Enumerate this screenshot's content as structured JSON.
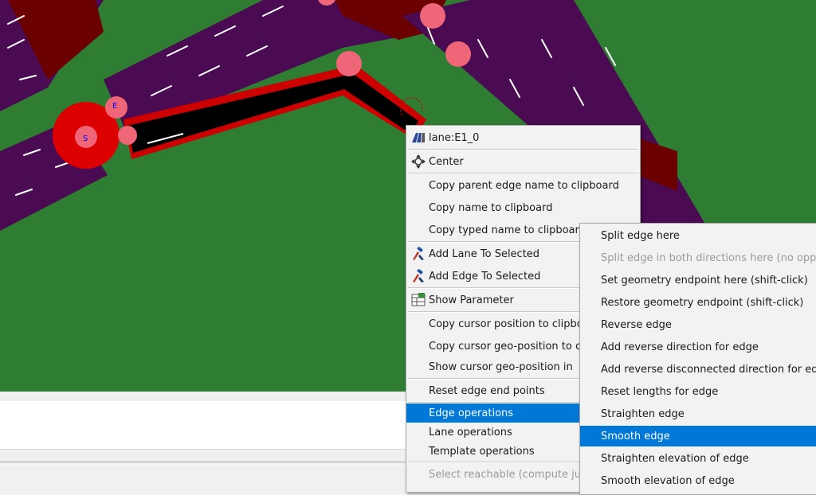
{
  "colors": {
    "grass": "#2e7d32",
    "road": "#4a0b52",
    "junction": "#7a0000",
    "selected_lane": "#000000",
    "highlight": "#0078d7",
    "node_marker": "#ee6677"
  },
  "map": {
    "junction_label": "S",
    "endpoint_label": "E"
  },
  "context_menu": {
    "title": "lane:E1_0",
    "title_icon": "lane-icon",
    "items": [
      {
        "label": "Center",
        "icon": "center-crosshair-icon"
      },
      {
        "label": "Copy parent edge name to clipboard"
      },
      {
        "label": "Copy name to clipboard"
      },
      {
        "label": "Copy typed name to clipboard"
      },
      {
        "label": "Add Lane To Selected",
        "icon": "add-selected-icon"
      },
      {
        "label": "Add Edge To Selected",
        "icon": "add-selected-icon"
      },
      {
        "label": "Show Parameter",
        "icon": "parameter-table-icon"
      },
      {
        "label": "Copy cursor position to clipboard"
      },
      {
        "label": "Copy cursor geo-position to clipboard"
      },
      {
        "label": "Show cursor geo-position in"
      },
      {
        "label": "Reset edge end points"
      },
      {
        "label": "Edge operations"
      },
      {
        "label": "Lane operations"
      },
      {
        "label": "Template operations"
      },
      {
        "label": "Select reachable (compute junctions)"
      }
    ]
  },
  "edge_submenu": {
    "items": [
      {
        "label": "Split edge here"
      },
      {
        "label": "Split edge in both directions here (no opposite edge)"
      },
      {
        "label": "Set geometry endpoint here (shift-click)"
      },
      {
        "label": "Restore geometry endpoint (shift-click)"
      },
      {
        "label": "Reverse edge"
      },
      {
        "label": "Add reverse direction for edge"
      },
      {
        "label": "Add reverse disconnected direction for edge"
      },
      {
        "label": "Reset lengths for edge"
      },
      {
        "label": "Straighten edge"
      },
      {
        "label": "Smooth edge"
      },
      {
        "label": "Straighten elevation of edge"
      },
      {
        "label": "Smooth elevation of edge"
      }
    ]
  }
}
